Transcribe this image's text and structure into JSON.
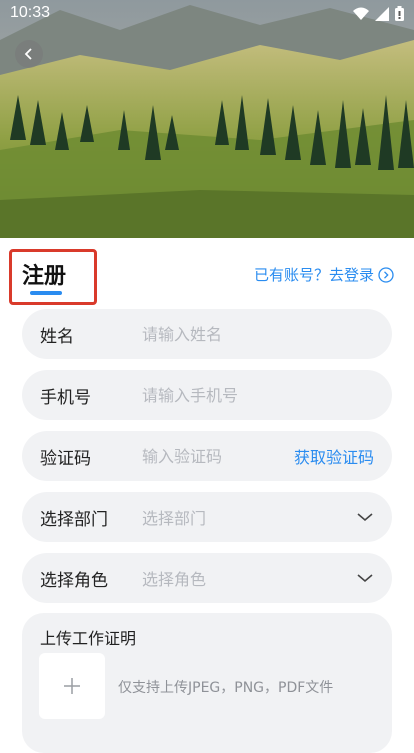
{
  "status_bar": {
    "time": "10:33"
  },
  "header": {
    "title": "注册",
    "login_link": "已有账号？去登录"
  },
  "form": {
    "name": {
      "label": "姓名",
      "placeholder": "请输入姓名"
    },
    "phone": {
      "label": "手机号",
      "placeholder": "请输入手机号"
    },
    "code": {
      "label": "验证码",
      "placeholder": "输入验证码",
      "button": "获取验证码"
    },
    "department": {
      "label": "选择部门",
      "placeholder": "选择部门"
    },
    "role": {
      "label": "选择角色",
      "placeholder": "选择角色"
    }
  },
  "upload": {
    "title": "上传工作证明",
    "hint": "仅支持上传JPEG，PNG，PDF文件"
  },
  "colors": {
    "accent": "#2a8cf0",
    "highlight_box": "#d93a2b",
    "field_bg": "#f1f2f4"
  },
  "icons": [
    "back-arrow-icon",
    "wifi-icon",
    "signal-icon",
    "battery-icon",
    "chevron-right-circle-icon",
    "chevron-down-icon",
    "plus-icon"
  ]
}
